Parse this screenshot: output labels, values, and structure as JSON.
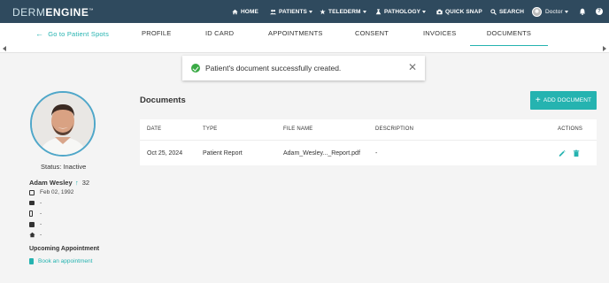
{
  "brand": {
    "part1": "DERM",
    "part2": "ENGINE",
    "mark": "™"
  },
  "topnav": {
    "home": "HOME",
    "patients": "PATIENTS",
    "telederm": "TELEDERM",
    "pathology": "PATHOLOGY",
    "quick_snap": "QUICK SNAP",
    "search": "SEARCH",
    "user": "Doctor"
  },
  "subnav": {
    "back": "Go to Patient Spots",
    "tabs": [
      "PROFILE",
      "ID CARD",
      "APPOINTMENTS",
      "CONSENT",
      "INVOICES",
      "DOCUMENTS"
    ],
    "active_tab": "DOCUMENTS"
  },
  "toast": {
    "message": "Patient's document successfully created."
  },
  "patient": {
    "status": "Status: Inactive",
    "name": "Adam Wesley",
    "age": "32",
    "dob": "Feb 02, 1992",
    "email": "-",
    "phone": "-",
    "work": "-",
    "address": "-",
    "upcoming_label": "Upcoming Appointment",
    "book_link": "Book an appointment"
  },
  "documents": {
    "title": "Documents",
    "add_button": "ADD DOCUMENT",
    "columns": [
      "DATE",
      "TYPE",
      "FILE NAME",
      "DESCRIPTION",
      "ACTIONS"
    ],
    "rows": [
      {
        "date": "Oct 25, 2024",
        "type": "Patient Report",
        "file_name": "Adam_Wesley..._Report.pdf",
        "description": "-"
      }
    ]
  },
  "colors": {
    "accent": "#25b3b0",
    "topbar": "#2f4a5e",
    "success": "#3aaa45"
  }
}
